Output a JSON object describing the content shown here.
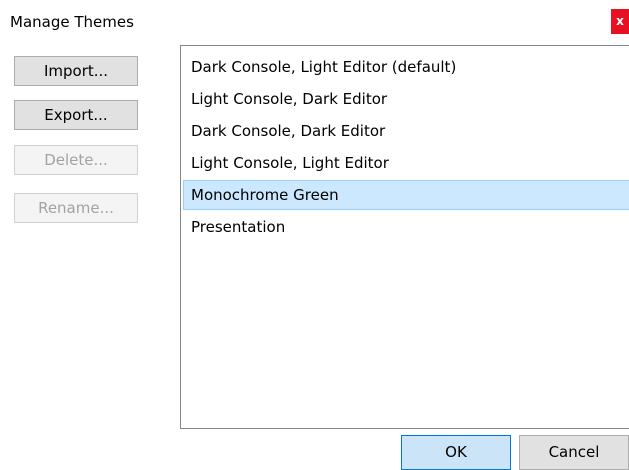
{
  "window": {
    "title": "Manage Themes",
    "close_label": "x"
  },
  "actions": {
    "import_label": "Import...",
    "export_label": "Export...",
    "delete_label": "Delete...",
    "rename_label": "Rename..."
  },
  "themes": [
    {
      "label": "Dark Console, Light Editor (default)",
      "selected": false
    },
    {
      "label": "Light Console, Dark Editor",
      "selected": false
    },
    {
      "label": "Dark Console, Dark Editor",
      "selected": false
    },
    {
      "label": "Light Console, Light Editor",
      "selected": false
    },
    {
      "label": "Monochrome Green",
      "selected": true
    },
    {
      "label": "Presentation",
      "selected": false
    }
  ],
  "footer": {
    "ok_label": "OK",
    "cancel_label": "Cancel"
  },
  "colors": {
    "selection_background": "#cce8ff",
    "selection_border": "#99d1ff",
    "close_button": "#e81123",
    "default_button_border": "#0078d7"
  }
}
